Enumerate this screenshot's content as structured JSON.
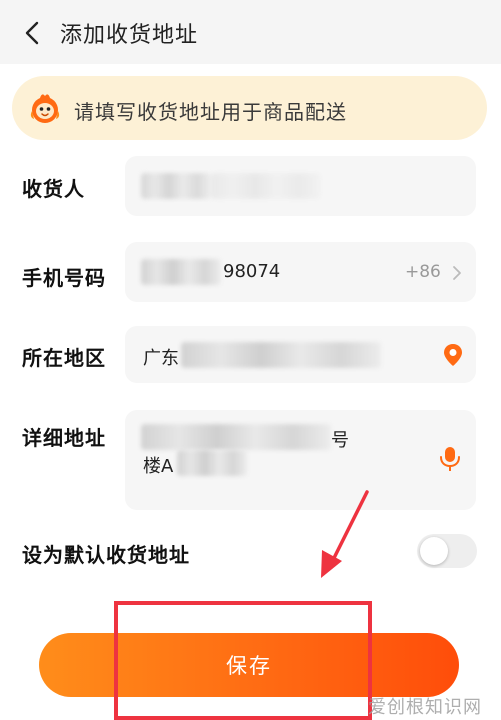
{
  "header": {
    "title": "添加收货地址"
  },
  "banner": {
    "text": "请填写收货地址用于商品配送"
  },
  "form": {
    "recipient": {
      "label": "收货人"
    },
    "phone": {
      "label": "手机号码",
      "visible_value": "98074",
      "country_code": "+86"
    },
    "region": {
      "label": "所在地区",
      "visible_value": "广东"
    },
    "address": {
      "label": "详细地址",
      "visible_end_line1": "号",
      "visible_start_line2": "楼A"
    },
    "default_toggle": {
      "label": "设为默认收货地址",
      "enabled": false
    }
  },
  "save_button": {
    "label": "保存"
  },
  "watermark": {
    "text": "爱创根知识网"
  },
  "colors": {
    "accent": "#ff6a13",
    "banner_bg": "#fdf1d6",
    "highlight": "#ee3340"
  },
  "icons": {
    "back": "chevron-left-icon",
    "mascot": "mascot-icon",
    "phone_chevron": "chevron-right-icon",
    "location": "location-pin-icon",
    "microphone": "microphone-icon"
  }
}
